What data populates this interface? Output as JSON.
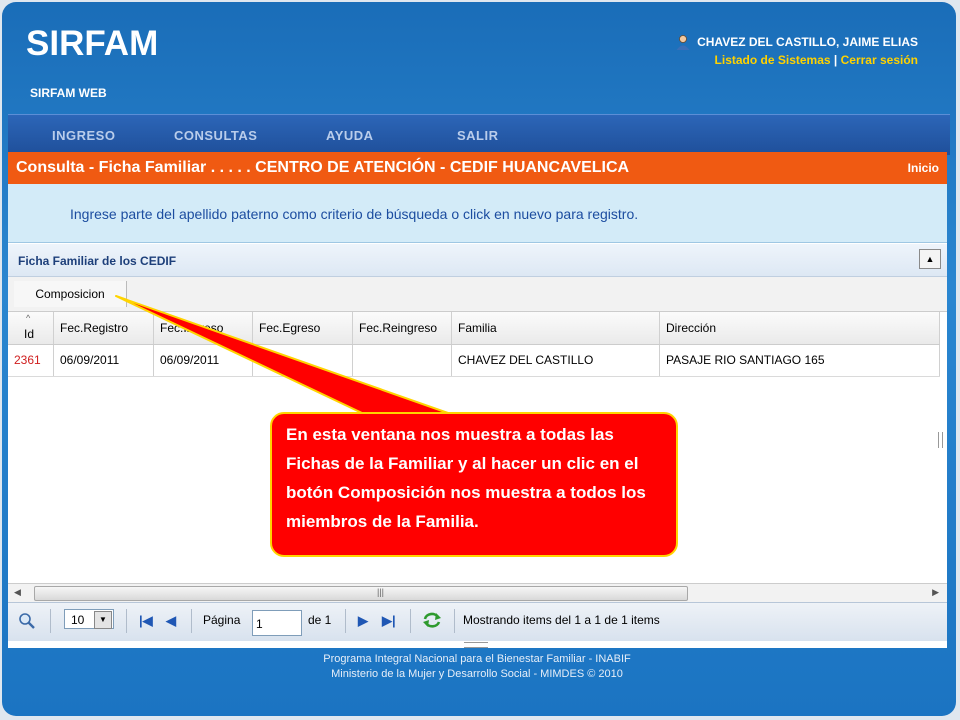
{
  "header": {
    "logo": "SIRFAM",
    "subtitle": "SIRFAM WEB",
    "user_name": "CHAVEZ DEL CASTILLO, JAIME ELIAS",
    "link_systems": "Listado de Sistemas",
    "link_separator": "|",
    "link_logout": "Cerrar sesión"
  },
  "nav": {
    "items": [
      {
        "label": "INGRESO"
      },
      {
        "label": "CONSULTAS"
      },
      {
        "label": "AYUDA"
      },
      {
        "label": "SALIR"
      }
    ]
  },
  "titlebar": {
    "title": "Consulta - Ficha Familiar . . . . . CENTRO DE ATENCIÓN - CEDIF HUANCAVELICA",
    "home_link": "Inicio"
  },
  "info": {
    "message": "Ingrese parte del apellido paterno como criterio de búsqueda o click en nuevo para registro."
  },
  "section": {
    "title": "Ficha Familiar de los CEDIF"
  },
  "toolbar": {
    "composition_button": "Composicion"
  },
  "grid": {
    "columns": [
      "Id",
      "Fec.Registro",
      "Fec.Ingreso",
      "Fec.Egreso",
      "Fec.Reingreso",
      "Familia",
      "Dirección"
    ],
    "rows": [
      [
        "2361",
        "06/09/2011",
        "06/09/2011",
        "",
        "",
        "CHAVEZ DEL CASTILLO",
        "PASAJE RIO SANTIAGO 165"
      ]
    ]
  },
  "pager": {
    "page_size": "10",
    "page_label": "Página",
    "page_value": "1",
    "of_label": "de 1",
    "status": "Mostrando items del 1 a 1 de 1 items"
  },
  "callout": {
    "text": "En esta ventana nos muestra a todas las Fichas de la Familiar y al hacer un clic en el botón Composición nos muestra a todos los miembros de la Familia."
  },
  "footer": {
    "line1": "Programa Integral Nacional para el Bienestar Familiar - INABIF",
    "line2": "Ministerio de la Mujer y Desarrollo Social - MIMDES © 2010"
  },
  "colors": {
    "accent_orange": "#f05a12",
    "brand_blue": "#1b74c2",
    "link_yellow": "#ffd200",
    "callout_red": "#ff0000"
  }
}
